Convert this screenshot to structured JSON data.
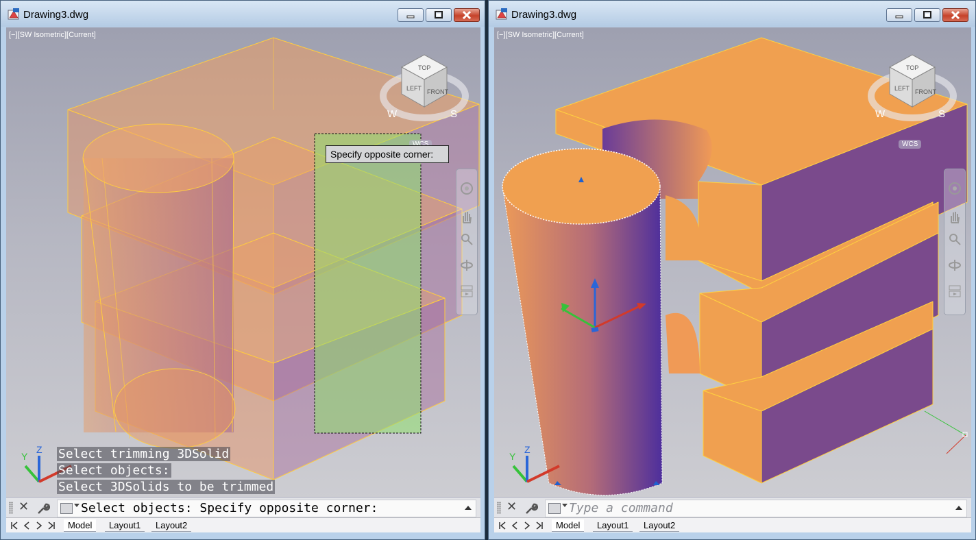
{
  "windows": [
    {
      "id": "left",
      "title": "Drawing3.dwg",
      "viewport_label": "[−][SW Isometric][Current]",
      "viewcube": {
        "top": "TOP",
        "left": "LEFT",
        "front": "FRONT",
        "compass_w": "W",
        "compass_s": "S",
        "wcs": "WCS"
      },
      "tooltip": "Specify opposite corner:",
      "ucs": {
        "y": "Y",
        "z": "Z"
      },
      "command_history": [
        "Select trimming 3DSolid",
        "Select objects:",
        "Select 3DSolids to be trimmed"
      ],
      "command_line": "Select objects: Specify opposite corner:",
      "command_placeholder": "",
      "tabs": [
        "Model",
        "Layout1",
        "Layout2"
      ]
    },
    {
      "id": "right",
      "title": "Drawing3.dwg",
      "viewport_label": "[−][SW Isometric][Current]",
      "viewcube": {
        "top": "TOP",
        "left": "LEFT",
        "front": "FRONT",
        "compass_w": "W",
        "compass_s": "S",
        "wcs": "WCS"
      },
      "ucs": {
        "y": "Y",
        "z": "Z"
      },
      "command_line": "",
      "command_placeholder": "Type a command",
      "tabs": [
        "Model",
        "Layout1",
        "Layout2"
      ]
    }
  ],
  "colors": {
    "solid_orange": "#f0a050",
    "solid_purple": "#7a4a8c",
    "selection_window": "#8fe06e",
    "viewport_bg_top": "#9ea0b0",
    "viewport_bg_bottom": "#cdcdd2"
  },
  "icons": [
    "autocad-app-icon",
    "minimize-icon",
    "restore-icon",
    "close-icon",
    "close-command-icon",
    "wrench-icon",
    "command-prompt-icon",
    "steering-wheel-icon",
    "pan-icon",
    "zoom-icon",
    "orbit-icon",
    "showmotion-icon",
    "viewcube-icon",
    "ucs-icon",
    "gizmo-icon"
  ]
}
